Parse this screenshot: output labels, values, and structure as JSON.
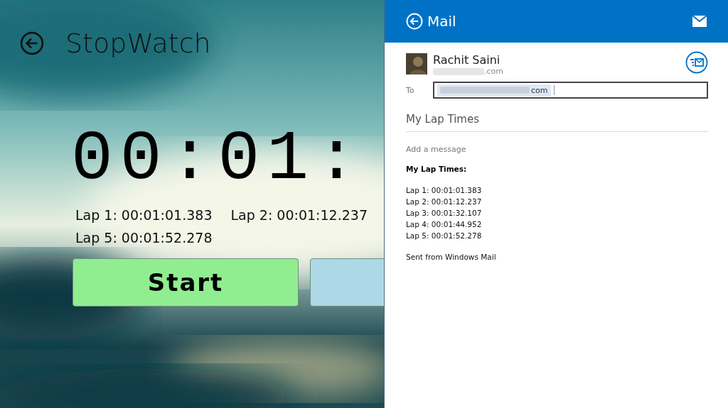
{
  "stopwatch": {
    "title": "StopWatch",
    "time": "00:01:",
    "laps": [
      "Lap 1: 00:01:01.383",
      "Lap 2: 00:01:12.237",
      "Lap 5: 00:01:52.278"
    ],
    "buttons": [
      {
        "label": "Start",
        "color": "#90ee90"
      },
      {
        "color": "#add8e6"
      }
    ]
  },
  "mail": {
    "title": "Mail",
    "sender": {
      "name": "Rachit Saini",
      "email": ".com"
    },
    "to_label": "To",
    "recipient": "com",
    "subject": "My Lap Times",
    "placeholder": "Add a message",
    "body_heading": "My Lap Times:",
    "body_lines": [
      "Lap 1: 00:01:01.383",
      "Lap 2: 00:01:12.237",
      "Lap 3: 00:01:32.107",
      "Lap 4: 00:01:44.952",
      "Lap 5: 00:01:52.278"
    ],
    "signature": "Sent from Windows Mail"
  }
}
